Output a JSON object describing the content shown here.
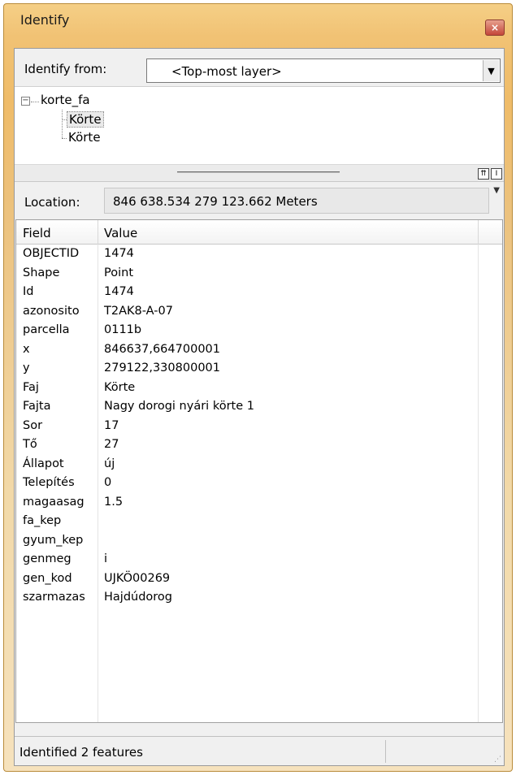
{
  "window": {
    "title": "Identify",
    "close_glyph": "×"
  },
  "identify_from": {
    "label": "Identify from:",
    "selected": "<Top-most layer>"
  },
  "tree": {
    "expander_glyph": "−",
    "root_label": "korte_fa",
    "children": [
      "Körte",
      "Körte"
    ]
  },
  "location": {
    "label": "Location:",
    "value": "846 638.534  279 123.662 Meters"
  },
  "grid": {
    "columns": [
      "Field",
      "Value"
    ],
    "rows": [
      {
        "field": "OBJECTID",
        "value": "1474"
      },
      {
        "field": "Shape",
        "value": "Point"
      },
      {
        "field": "Id",
        "value": "1474"
      },
      {
        "field": "azonosito",
        "value": "T2AK8-A-07"
      },
      {
        "field": "parcella",
        "value": "0111b"
      },
      {
        "field": "x",
        "value": "846637,664700001"
      },
      {
        "field": "y",
        "value": "279122,330800001"
      },
      {
        "field": "Faj",
        "value": "Körte"
      },
      {
        "field": "Fajta",
        "value": "Nagy dorogi nyári körte 1"
      },
      {
        "field": "Sor",
        "value": "17"
      },
      {
        "field": "Tő",
        "value": "27"
      },
      {
        "field": "Állapot",
        "value": "új"
      },
      {
        "field": "Telepítés",
        "value": "0"
      },
      {
        "field": "magaasag",
        "value": "1.5"
      },
      {
        "field": "fa_kep",
        "value": ""
      },
      {
        "field": "gyum_kep",
        "value": ""
      },
      {
        "field": "genmeg",
        "value": "i"
      },
      {
        "field": "gen_kod",
        "value": "UJKÖ00269"
      },
      {
        "field": "szarmazas",
        "value": "Hajdúdorog"
      }
    ]
  },
  "status": {
    "text": "Identified 2 features"
  },
  "colors": {
    "window_frame": "#f1c274",
    "close_button": "#c4473a"
  }
}
